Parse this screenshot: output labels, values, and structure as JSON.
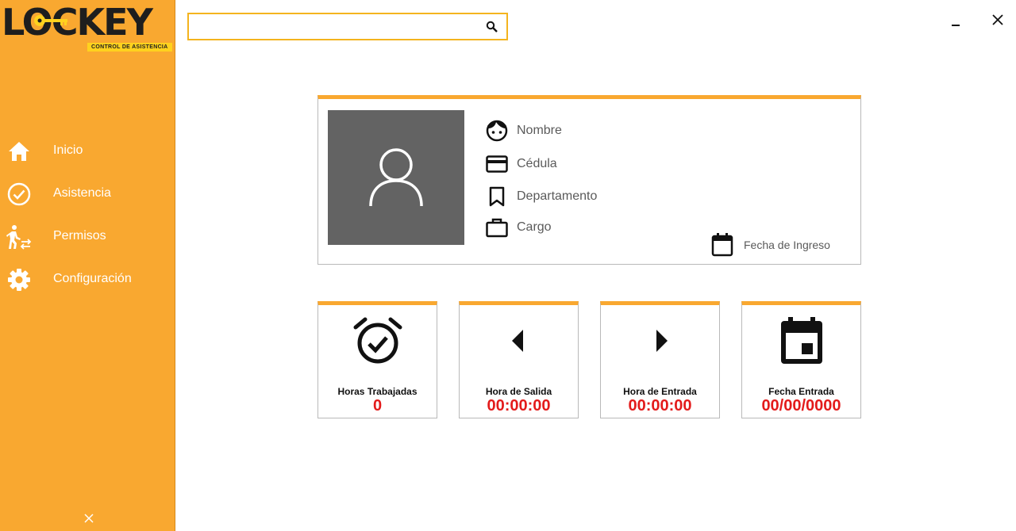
{
  "brand": {
    "name": "LOCKEY",
    "tagline": "CONTROL DE ASISTENCIA",
    "accent": "#f9a830",
    "value_color": "#e31b1b"
  },
  "search": {
    "value": "",
    "placeholder": "",
    "icon": "search-icon"
  },
  "window": {
    "minimize_icon": "minimize-icon",
    "close_icon": "close-icon"
  },
  "sidebar": {
    "items": [
      {
        "label": "Inicio",
        "icon": "home-icon"
      },
      {
        "label": "Asistencia",
        "icon": "check-circle-icon"
      },
      {
        "label": "Permisos",
        "icon": "person-transfer-icon"
      },
      {
        "label": "Configuración",
        "icon": "gear-icon"
      }
    ],
    "close_icon": "close-icon"
  },
  "profile": {
    "photo_icon": "user-icon",
    "fields": [
      {
        "label": "Nombre",
        "icon": "face-icon"
      },
      {
        "label": "Cédula",
        "icon": "card-icon"
      },
      {
        "label": "Departamento",
        "icon": "bookmark-icon"
      },
      {
        "label": "Cargo",
        "icon": "briefcase-icon"
      }
    ],
    "fecha_ingreso": {
      "label": "Fecha de Ingreso",
      "icon": "calendar-icon"
    }
  },
  "stats": [
    {
      "label": "Horas Trabajadas",
      "value": "0",
      "icon": "alarm-check-icon"
    },
    {
      "label": "Hora de Salida",
      "value": "00:00:00",
      "icon": "arrow-left-icon"
    },
    {
      "label": "Hora de Entrada",
      "value": "00:00:00",
      "icon": "arrow-right-icon"
    },
    {
      "label": "Fecha Entrada",
      "value": "00/00/0000",
      "icon": "event-icon"
    }
  ]
}
